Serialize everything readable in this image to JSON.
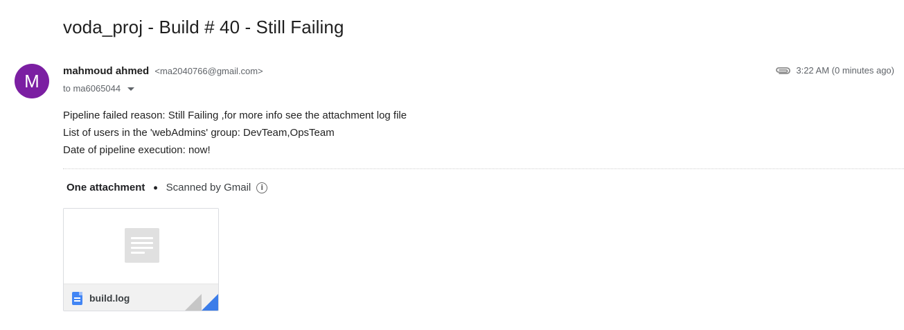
{
  "email": {
    "subject": "voda_proj - Build # 40 - Still Failing",
    "avatar_letter": "M",
    "avatar_color": "#7b1fa2",
    "sender_name": "mahmoud ahmed",
    "sender_email": "<ma2040766@gmail.com>",
    "to_line": "to ma6065044",
    "time": "3:22 AM (0 minutes ago)",
    "body_lines": [
      "Pipeline failed reason: Still Failing ,for more info see the attachment log file",
      "List of users in the 'webAdmins' group: DevTeam,OpsTeam",
      "Date of pipeline execution: now!"
    ]
  },
  "attachments": {
    "count_label": "One attachment",
    "separator": "•",
    "scanned_label": "Scanned by Gmail",
    "info_glyph": "i",
    "files": [
      {
        "name": "build.log",
        "icon": "document-icon",
        "accent": "#4285f4"
      }
    ]
  }
}
